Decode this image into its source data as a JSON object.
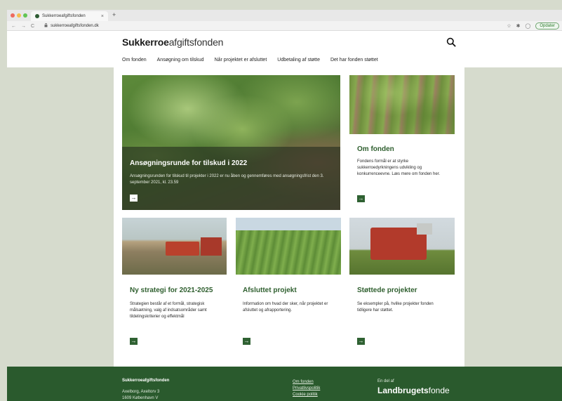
{
  "browser": {
    "tab_title": "Sukkerroeafgiftsfonden",
    "tab_close": "×",
    "new_tab": "+",
    "back": "←",
    "forward": "→",
    "reload": "C",
    "url": "sukkerroeafgiftsfonden.dk",
    "update_label": "Opdater"
  },
  "site": {
    "logo_bold": "Sukkerroe",
    "logo_rest": "afgiftsfonden"
  },
  "menu": [
    "Om fonden",
    "Ansøgning om tilskud",
    "Når projektet er afsluttet",
    "Udbetaling af støtte",
    "Det har fonden støttet"
  ],
  "hero": {
    "title": "Ansøgningsrunde for tilskud i 2022",
    "text": "Ansøgningsrunden for tilskud til projekter i 2022 er nu åben og gennemføres med ansøgningsfrist den 3. september 2021, kl. 23.59",
    "arrow": "→"
  },
  "cards": {
    "om": {
      "title": "Om fonden",
      "text": "Fondens formål er at styrke sukkerroedyrkningens udvikling og konkurrenceevne. Læs mere om fonden her.",
      "arrow": "→"
    },
    "strategi": {
      "title": "Ny strategi for 2021-2025",
      "text": "Strategien består af et formål, strategisk målsætning, valg af indsatsområder samt tildelingskriterier og effektmål",
      "arrow": "→"
    },
    "afsluttet": {
      "title": "Afsluttet projekt",
      "text": "Information om hvad der sker, når projektet er afsluttet og afrapportering.",
      "arrow": "→"
    },
    "stottede": {
      "title": "Støttede projekter",
      "text": "Se eksempler på, hvilke projekter fonden tidligere har støttet.",
      "arrow": "→"
    }
  },
  "footer": {
    "name": "Sukkerroeafgiftsfonden",
    "address_line1": "Axelborg, Axeltorv 3",
    "address_line2": "1609 København V",
    "links": [
      "Om fonden",
      "Privatlivspolitik",
      "Cookie politik"
    ],
    "part_of": "En del af",
    "brand_bold": "Landbrugets",
    "brand_rest": "fonde"
  },
  "colors": {
    "brand_green": "#2f6132",
    "footer_green": "#2a5a2d",
    "page_bg": "#d6dbcd"
  },
  "icons": [
    "search-icon",
    "arrow-right-icon",
    "lock-icon",
    "star-icon",
    "extension-icon",
    "profile-icon"
  ]
}
